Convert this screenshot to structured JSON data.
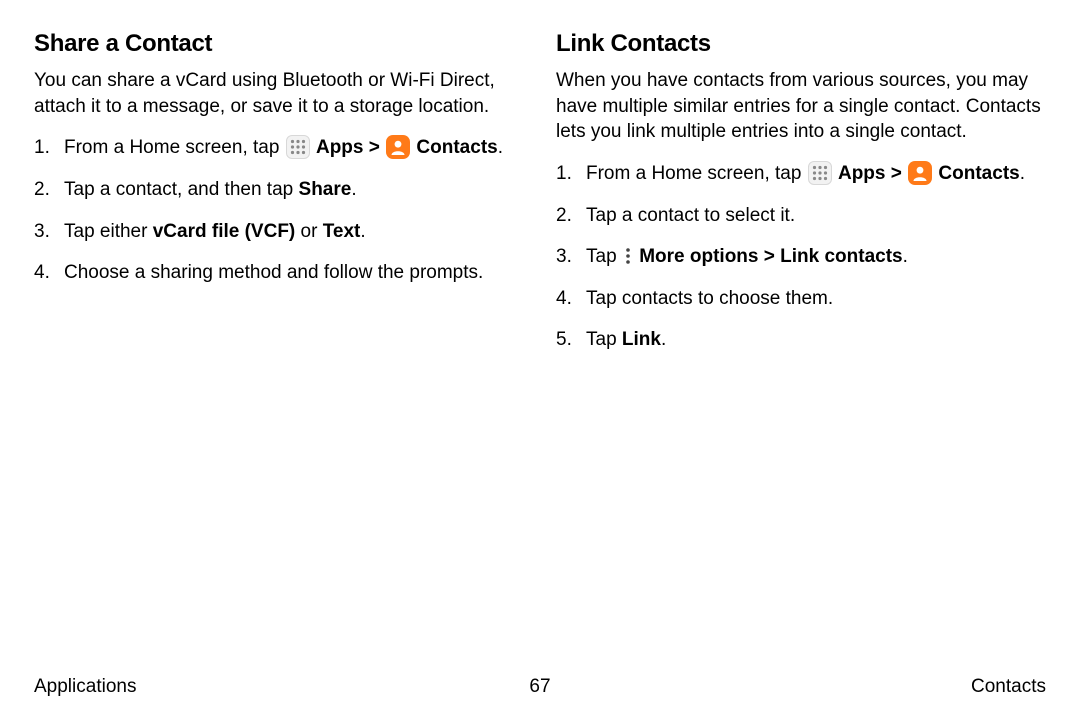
{
  "left": {
    "heading": "Share a Contact",
    "intro": "You can share a vCard using Bluetooth or Wi-Fi Direct, attach it to a message, or save it to a storage location.",
    "s1_pre": "From a Home screen, tap ",
    "apps": "Apps",
    "chev": " > ",
    "contacts": "Contacts",
    "s2_pre": "Tap a contact, and then tap ",
    "s2_bold": "Share",
    "s3_pre": "Tap either ",
    "s3_bold1": "vCard file (VCF)",
    "s3_mid": " or ",
    "s3_bold2": "Text",
    "s4": "Choose a sharing method and follow the prompts."
  },
  "right": {
    "heading": "Link Contacts",
    "intro": "When you have contacts from various sources, you may have multiple similar entries for a single contact. Contacts lets you link multiple entries into a single contact.",
    "s1_pre": "From a Home screen, tap ",
    "apps": "Apps",
    "chev": " > ",
    "contacts": "Contacts",
    "s2": "Tap a contact to select it.",
    "s3_pre": "Tap ",
    "s3_bold": "More options > Link contacts",
    "s4": "Tap contacts to choose them.",
    "s5_pre": "Tap ",
    "s5_bold": "Link"
  },
  "footer": {
    "left": "Applications",
    "center": "67",
    "right": "Contacts"
  }
}
